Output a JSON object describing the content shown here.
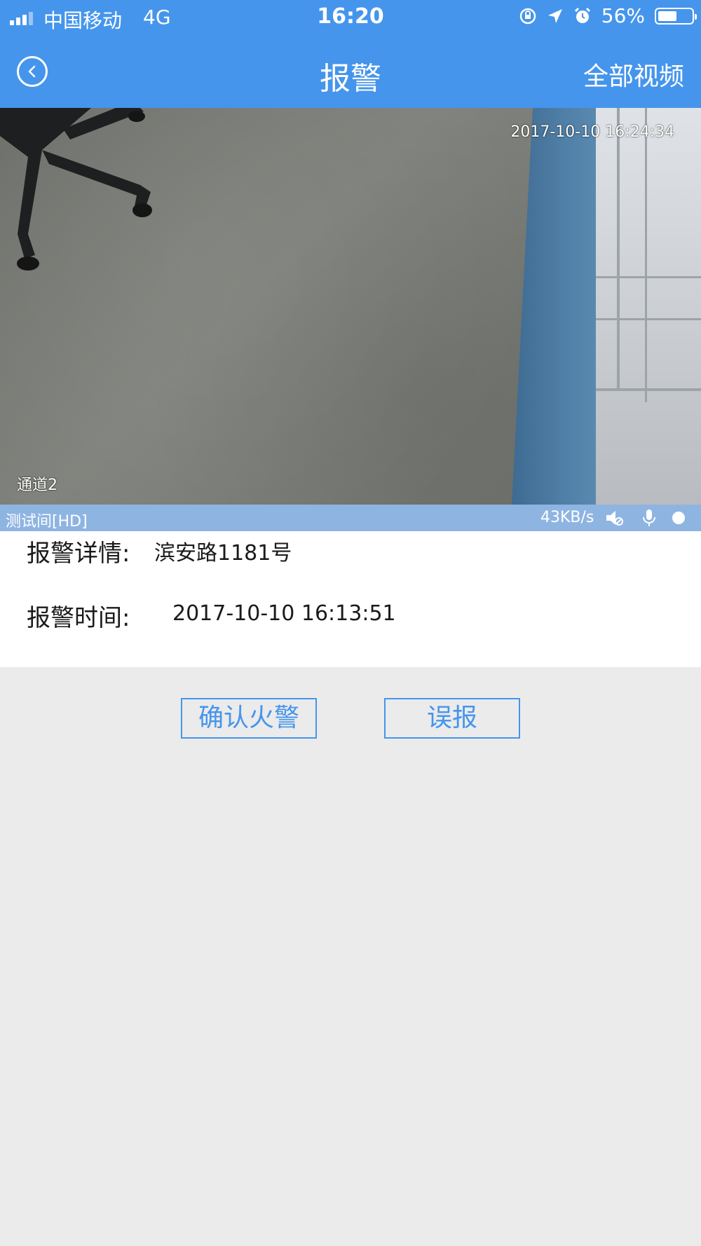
{
  "status_bar": {
    "carrier": "中国移动",
    "network": "4G",
    "time": "16:20",
    "battery": "56%",
    "battery_level": 0.56
  },
  "nav": {
    "title": "报警",
    "right_link": "全部视频",
    "back_icon": "chevron-left-circle-icon"
  },
  "video": {
    "timestamp": "2017-10-10 16:24:34",
    "channel": "通道2",
    "device_name": "测试间[HD]",
    "speed": "43KB/s",
    "controls": [
      "mute-icon",
      "microphone-icon",
      "record-icon"
    ]
  },
  "alarm": {
    "detail_label": "报警详情:",
    "detail_value": "滨安路1181号",
    "time_label": "报警时间:",
    "time_value": "2017-10-10 16:13:51"
  },
  "actions": {
    "confirm": "确认火警",
    "false_alarm": "误报"
  },
  "colors": {
    "accent": "#4595ec",
    "video_bar": "#8eb4e2",
    "background": "#ebebeb"
  }
}
